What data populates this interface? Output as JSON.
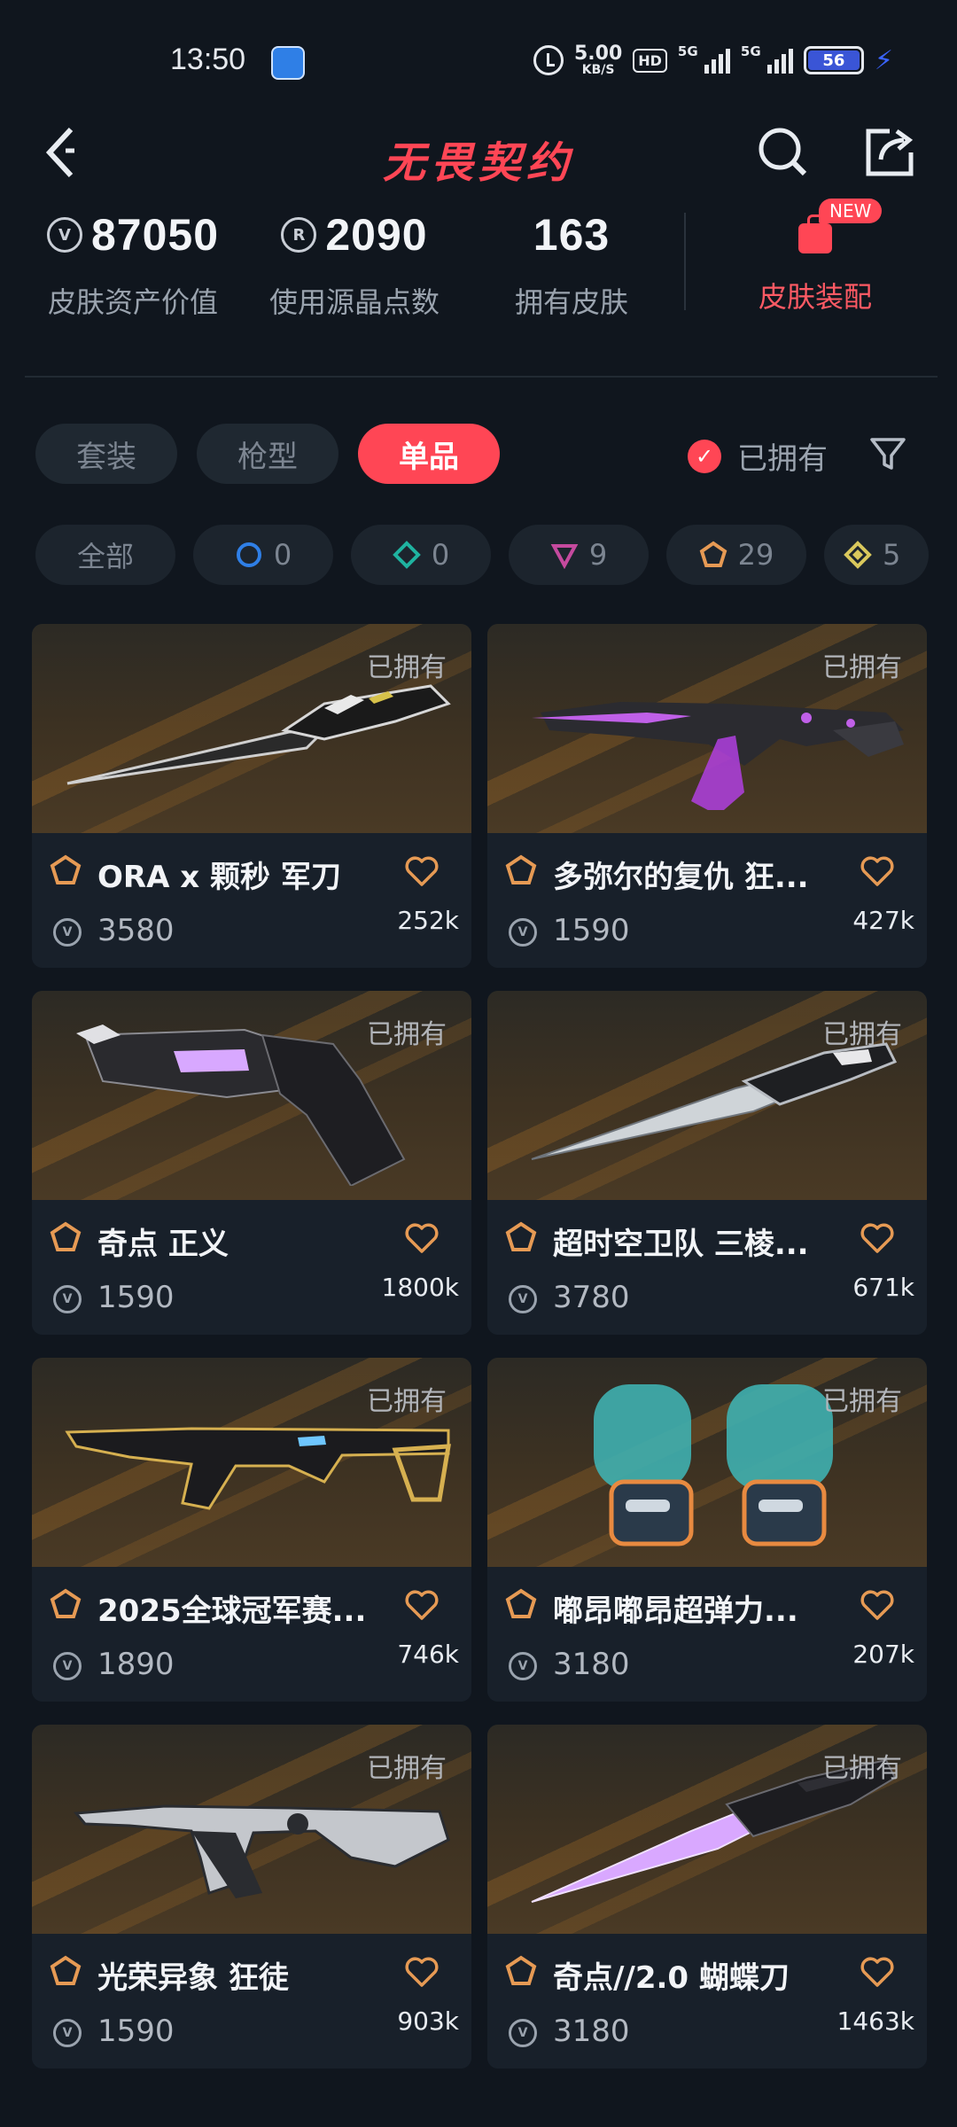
{
  "status_bar": {
    "time": "13:50",
    "net_speed_value": "5.00",
    "net_speed_unit": "KB/S",
    "hd_label": "HD",
    "signal1_label": "5G",
    "signal2_label": "5G",
    "battery_level": "56"
  },
  "header": {
    "title": "无畏契约"
  },
  "stats": {
    "asset_value": "87050",
    "asset_value_label": "皮肤资产价值",
    "radianite_points": "2090",
    "radianite_points_label": "使用源晶点数",
    "owned_count": "163",
    "owned_count_label": "拥有皮肤",
    "loadout_badge": "NEW",
    "loadout_label": "皮肤装配"
  },
  "tabs": [
    {
      "label": "套装",
      "active": false
    },
    {
      "label": "枪型",
      "active": false
    },
    {
      "label": "单品",
      "active": true
    }
  ],
  "owned_filter": {
    "checked": true,
    "label": "已拥有"
  },
  "rarity_chips": [
    {
      "label": "全部",
      "icon": "all"
    },
    {
      "count": "0",
      "icon": "select-tier-icon",
      "color": "#2f7fe6"
    },
    {
      "count": "0",
      "icon": "deluxe-tier-icon",
      "color": "#1fb3a0"
    },
    {
      "count": "9",
      "icon": "premium-tier-icon",
      "color": "#c54a9e"
    },
    {
      "count": "29",
      "icon": "exclusive-tier-icon",
      "color": "#e69a54"
    },
    {
      "count": "5",
      "icon": "ultra-tier-icon",
      "color": "#d9c85c"
    }
  ],
  "skins": [
    {
      "name": "ORA x 颗秒 军刀",
      "price": "3580",
      "likes": "252k",
      "owned": "已拥有",
      "tier_icon": "exclusive-tier-icon",
      "weapon": "knife"
    },
    {
      "name": "多弥尔的复仇 狂...",
      "price": "1590",
      "likes": "427k",
      "owned": "已拥有",
      "tier_icon": "exclusive-tier-icon",
      "weapon": "rifle-purple"
    },
    {
      "name": "奇点 正义",
      "price": "1590",
      "likes": "1800k",
      "owned": "已拥有",
      "tier_icon": "exclusive-tier-icon",
      "weapon": "revolver"
    },
    {
      "name": "超时空卫队 三棱...",
      "price": "3780",
      "likes": "671k",
      "owned": "已拥有",
      "tier_icon": "exclusive-tier-icon",
      "weapon": "dagger"
    },
    {
      "name": "2025全球冠军赛...",
      "price": "1890",
      "likes": "746k",
      "owned": "已拥有",
      "tier_icon": "exclusive-tier-icon",
      "weapon": "rifle-gold"
    },
    {
      "name": "嘟昂嘟昂超弹力...",
      "price": "3180",
      "likes": "207k",
      "owned": "已拥有",
      "tier_icon": "exclusive-tier-icon",
      "weapon": "gloves"
    },
    {
      "name": "光荣异象 狂徒",
      "price": "1590",
      "likes": "903k",
      "owned": "已拥有",
      "tier_icon": "exclusive-tier-icon",
      "weapon": "rifle-silver"
    },
    {
      "name": "奇点//2.0 蝴蝶刀",
      "price": "3180",
      "likes": "1463k",
      "owned": "已拥有",
      "tier_icon": "exclusive-tier-icon",
      "weapon": "butterfly"
    }
  ],
  "colors": {
    "accent": "#ff4655",
    "background": "#10161e",
    "card": "#18202a",
    "tier_exclusive": "#e69a54"
  }
}
